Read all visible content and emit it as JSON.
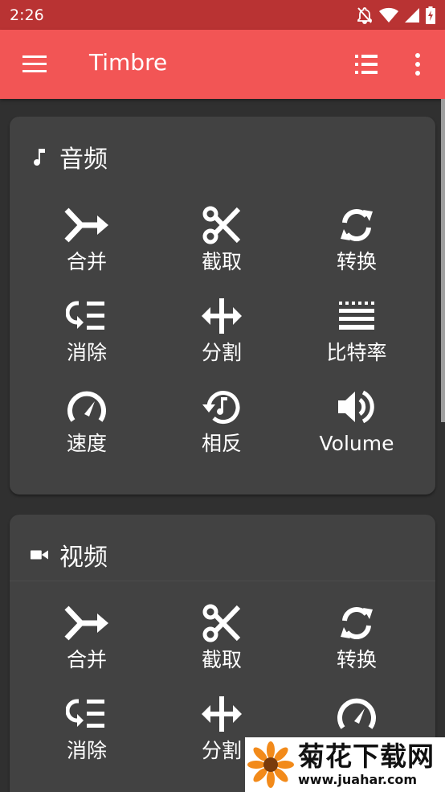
{
  "status_bar": {
    "time": "2:26"
  },
  "app_bar": {
    "title": "Timbre",
    "color": "#f25555"
  },
  "audio_card": {
    "title": "音频",
    "tools": [
      {
        "label": "合并",
        "icon": "merge-icon"
      },
      {
        "label": "截取",
        "icon": "scissors-icon"
      },
      {
        "label": "转换",
        "icon": "sync-icon"
      },
      {
        "label": "消除",
        "icon": "remove-list-icon"
      },
      {
        "label": "分割",
        "icon": "split-arrows-icon"
      },
      {
        "label": "比特率",
        "icon": "bitrate-icon"
      },
      {
        "label": "速度",
        "icon": "speedometer-icon"
      },
      {
        "label": "相反",
        "icon": "reverse-music-icon"
      },
      {
        "label": "Volume",
        "icon": "volume-icon"
      }
    ]
  },
  "video_card": {
    "title": "视频",
    "tools": [
      {
        "label": "合并",
        "icon": "merge-icon"
      },
      {
        "label": "截取",
        "icon": "scissors-icon"
      },
      {
        "label": "转换",
        "icon": "sync-icon"
      },
      {
        "label": "消除",
        "icon": "remove-list-icon"
      },
      {
        "label": "分割",
        "icon": "split-arrows-icon"
      },
      {
        "label": "",
        "icon": "speedometer-icon"
      }
    ]
  },
  "watermark": {
    "name": "菊花下载网",
    "url": "www.juahar.com"
  }
}
